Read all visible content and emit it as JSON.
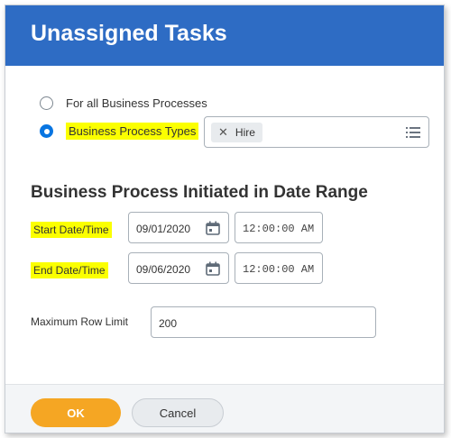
{
  "dialog": {
    "title": "Unassigned Tasks",
    "header_color": "#2e6cc4"
  },
  "process_selection": {
    "option_all": "For all Business Processes",
    "option_types": "Business Process Types",
    "selected": "option_types",
    "types_selected": [
      "Hire"
    ],
    "types_field_icon": "list-icon"
  },
  "date_range": {
    "heading": "Business Process Initiated in Date Range",
    "start_label": "Start Date/Time",
    "start_date": "09/01/2020",
    "start_time": "12:00:00 AM",
    "end_label": "End Date/Time",
    "end_date": "09/06/2020",
    "end_time": "12:00:00 AM",
    "calendar_icon": "calendar-icon"
  },
  "row_limit": {
    "label": "Maximum Row Limit",
    "value": "200"
  },
  "footer": {
    "ok_label": "OK",
    "cancel_label": "Cancel",
    "ok_color": "#f5a623"
  },
  "highlight_color": "#fbff00",
  "accent_color": "#0875e1"
}
